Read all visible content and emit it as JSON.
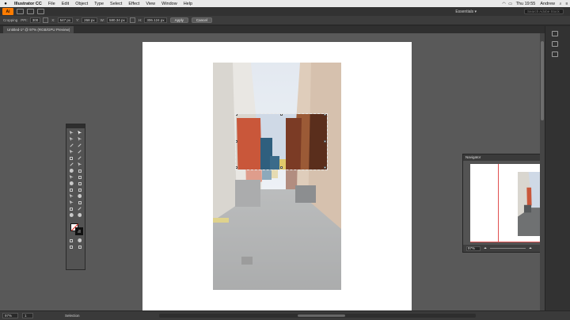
{
  "menubar": {
    "app_name": "Illustrator CC",
    "items": [
      "File",
      "Edit",
      "Object",
      "Type",
      "Select",
      "Effect",
      "View",
      "Window",
      "Help"
    ],
    "clock": "Thu 19:55",
    "user": "Andrew"
  },
  "appbar": {
    "logo": "Ai",
    "workspace": "Essentials ▾",
    "search_placeholder": "Search Adobe Stock"
  },
  "controlbar": {
    "mode_label": "Cropping",
    "ppi_label": "PPI:",
    "ppi_value": "300",
    "x_label": "X:",
    "x_value": "547 px",
    "y_label": "Y:",
    "y_value": "268 px",
    "w_label": "W:",
    "w_value": "580.34 px",
    "h_label": "H:",
    "h_value": "306.124 px",
    "apply_label": "Apply",
    "cancel_label": "Cancel"
  },
  "document": {
    "tab_title": "Untitled-1* @ 97% (RGB/GPU Preview)"
  },
  "navigator": {
    "title": "Navigator",
    "zoom_value": "97%",
    "zoom_out_glyph": "⏶",
    "zoom_in_glyph": "⏶"
  },
  "statusbar": {
    "zoom_value": "97%",
    "artboard_value": "1",
    "status_text": "Selection"
  },
  "colors": {
    "accent": "#ff7c00",
    "canvas_bg": "#595959",
    "panel_bg": "#535353"
  }
}
